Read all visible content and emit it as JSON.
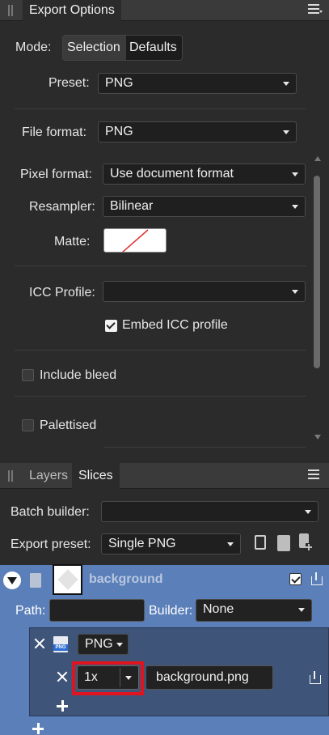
{
  "export_options": {
    "title": "Export Options",
    "mode_label": "Mode:",
    "mode_options": [
      "Selection",
      "Defaults"
    ],
    "preset_label": "Preset:",
    "preset_value": "PNG",
    "file_format_label": "File format:",
    "file_format_value": "PNG",
    "pixel_format_label": "Pixel format:",
    "pixel_format_value": "Use document format",
    "resampler_label": "Resampler:",
    "resampler_value": "Bilinear",
    "matte_label": "Matte:",
    "icc_label": "ICC Profile:",
    "icc_value": "",
    "embed_icc_label": "Embed ICC profile",
    "embed_icc_checked": true,
    "include_bleed_label": "Include bleed",
    "include_bleed_checked": false,
    "palettised_label": "Palettised",
    "palettised_checked": false
  },
  "bottom_panel": {
    "tabs": [
      "Layers",
      "Slices"
    ],
    "active_tab": "Slices",
    "batch_builder_label": "Batch builder:",
    "batch_builder_value": "",
    "export_preset_label": "Export preset:",
    "export_preset_value": "Single PNG"
  },
  "slice": {
    "name": "background",
    "checked": true,
    "path_label": "Path:",
    "path_value": "",
    "builder_label": "Builder:",
    "builder_value": "None",
    "format_value": "PNG",
    "format_badge": "PNG",
    "scale_value": "1x",
    "filename_value": "background.png"
  },
  "colors": {
    "panel_bg": "#2b2b2b",
    "selection_blue": "#5b7fb8",
    "highlight_red": "#e0141e",
    "matte_line": "#e03030"
  }
}
